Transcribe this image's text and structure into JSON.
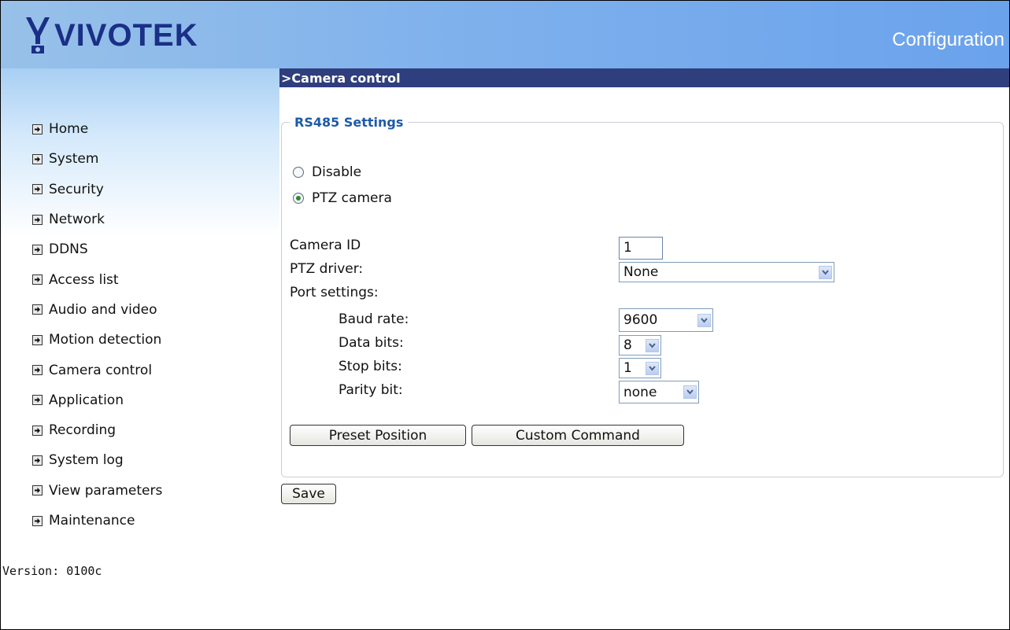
{
  "header": {
    "logo_text": "VIVOTEK",
    "title": "Configuration"
  },
  "sidebar": {
    "items": [
      {
        "label": "Home"
      },
      {
        "label": "System"
      },
      {
        "label": "Security"
      },
      {
        "label": "Network"
      },
      {
        "label": "DDNS"
      },
      {
        "label": "Access list"
      },
      {
        "label": "Audio and video"
      },
      {
        "label": "Motion detection"
      },
      {
        "label": "Camera control"
      },
      {
        "label": "Application"
      },
      {
        "label": "Recording"
      },
      {
        "label": "System log"
      },
      {
        "label": "View parameters"
      },
      {
        "label": "Maintenance"
      }
    ],
    "version": "Version: 0100c"
  },
  "section": {
    "title": ">Camera control"
  },
  "rs485": {
    "legend": "RS485 Settings",
    "radio_disable": {
      "label": "Disable",
      "checked": false
    },
    "radio_ptz": {
      "label": "PTZ camera",
      "checked": true
    },
    "camera_id": {
      "label": "Camera ID",
      "value": "1"
    },
    "ptz_driver": {
      "label": "PTZ driver:",
      "value": "None"
    },
    "port_settings_label": "Port settings:",
    "baud_rate": {
      "label": "Baud rate:",
      "value": "9600"
    },
    "data_bits": {
      "label": "Data bits:",
      "value": "8"
    },
    "stop_bits": {
      "label": "Stop bits:",
      "value": "1"
    },
    "parity_bit": {
      "label": "Parity bit:",
      "value": "none"
    },
    "preset_button": "Preset Position",
    "custom_button": "Custom Command"
  },
  "save_button": "Save",
  "colors": {
    "section_bar": "#2f3e7c",
    "legend_text": "#1d5aa8",
    "logo": "#1a2f86"
  },
  "icons": {
    "nav_bullet": "arrow-right-icon",
    "dropdown": "chevron-down-icon"
  }
}
